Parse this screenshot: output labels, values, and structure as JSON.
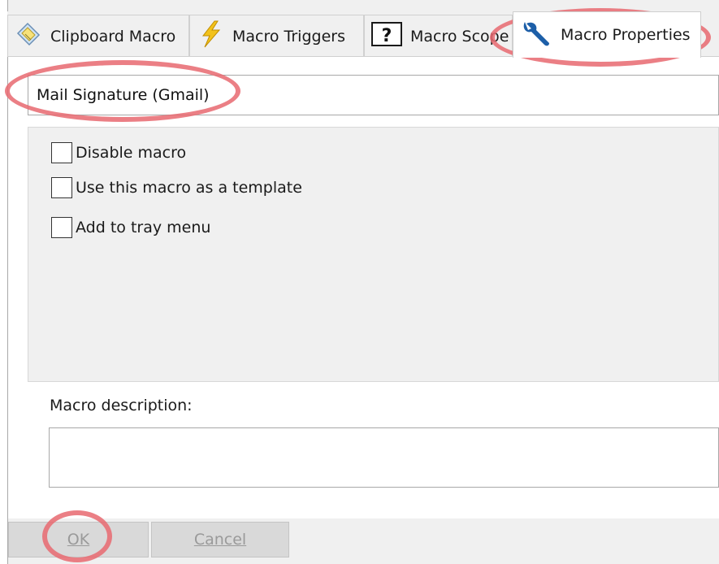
{
  "tabs": [
    {
      "label": "Clipboard Macro",
      "icon": "clipboard-icon"
    },
    {
      "label": "Macro Triggers",
      "icon": "lightning-icon"
    },
    {
      "label": "Macro Scope",
      "icon": "question-icon"
    },
    {
      "label": "Macro Properties",
      "icon": "wrench-icon",
      "active": true
    }
  ],
  "properties": {
    "macro_name": "Mail Signature (Gmail)",
    "options": [
      {
        "label": "Disable macro",
        "checked": false
      },
      {
        "label": "Use this macro as a template",
        "checked": false
      },
      {
        "label": "Add to tray menu",
        "checked": false
      }
    ],
    "description_label": "Macro description:",
    "description_value": ""
  },
  "buttons": {
    "ok_label": "OK",
    "cancel_label": "Cancel"
  },
  "colors": {
    "annotation": "#e86870",
    "wrench_blue": "#1d5fa8",
    "lightning_yellow": "#f2c21b"
  }
}
